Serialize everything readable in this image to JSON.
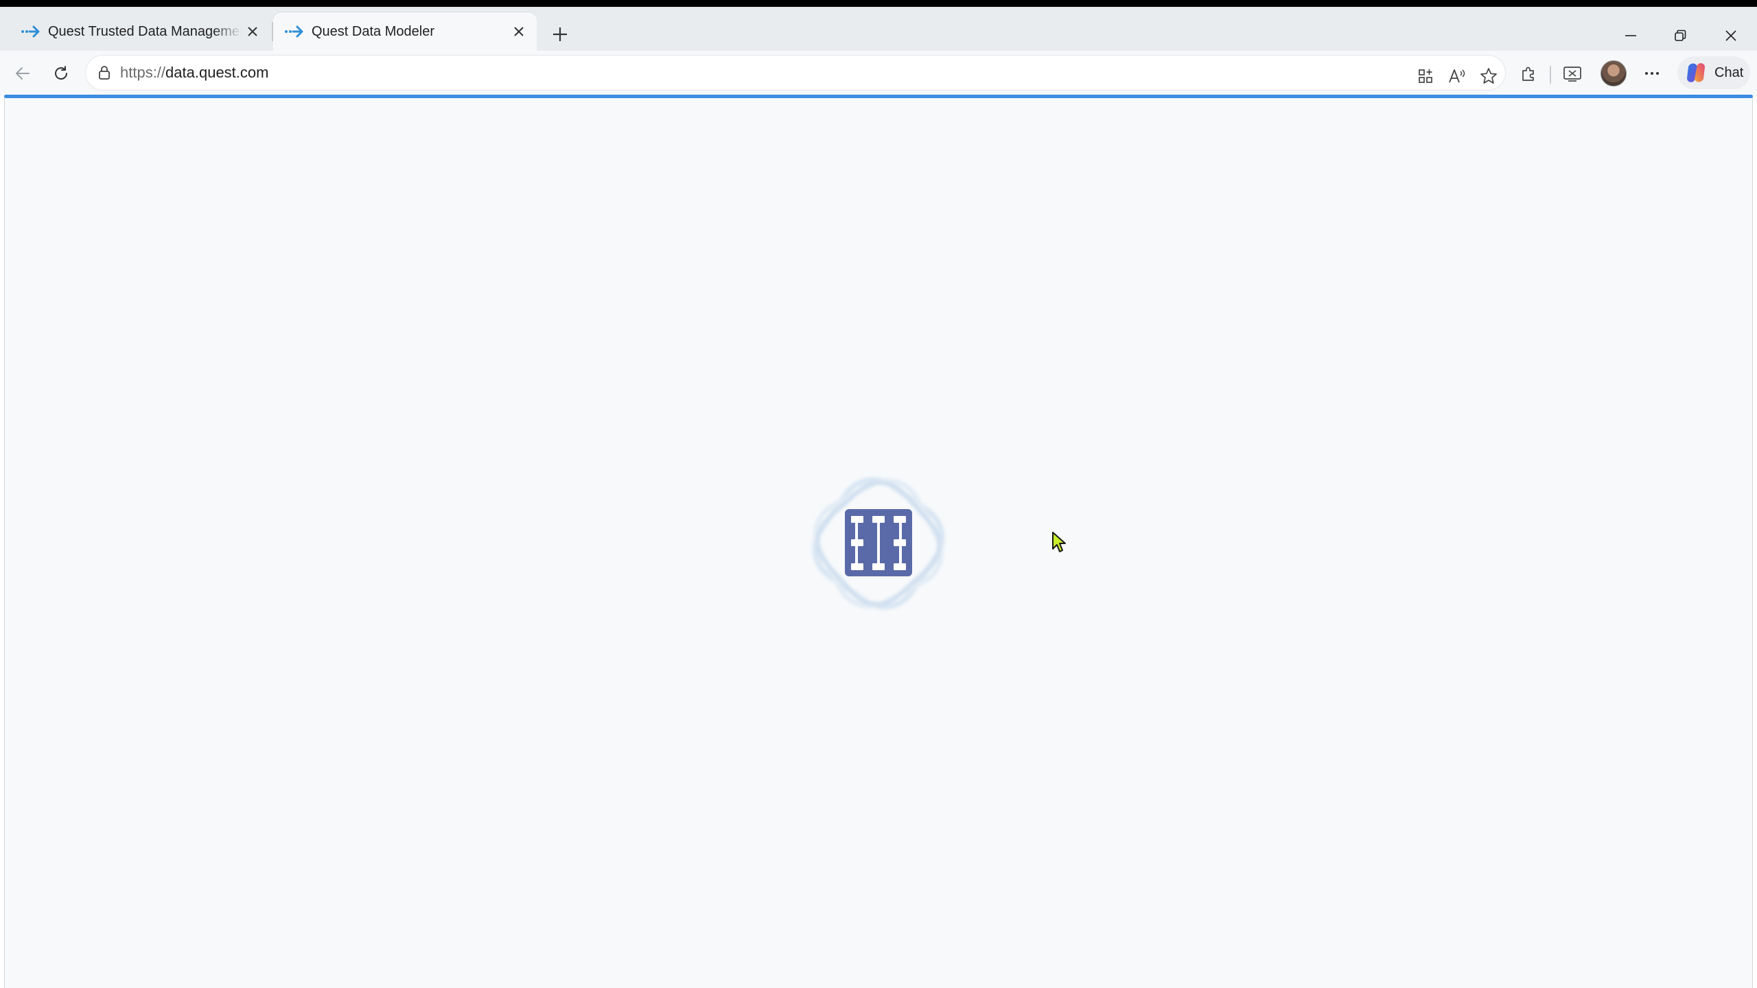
{
  "browser": {
    "tabs": [
      {
        "title": "Quest Trusted Data Management P",
        "active": false,
        "icon": "quest-arrow-icon"
      },
      {
        "title": "Quest Data Modeler",
        "active": true,
        "icon": "quest-arrow-icon"
      }
    ],
    "address": {
      "scheme": "https://",
      "host": "data.quest.com"
    },
    "toolbar": {
      "chat_label": "Chat"
    },
    "colors": {
      "accent": "#3b8be0",
      "loader_logo": "#5a6aa8",
      "loader_ring": "#cdddee"
    }
  },
  "page": {
    "state": "loading",
    "loader_icon": "data-model-grid-icon"
  }
}
